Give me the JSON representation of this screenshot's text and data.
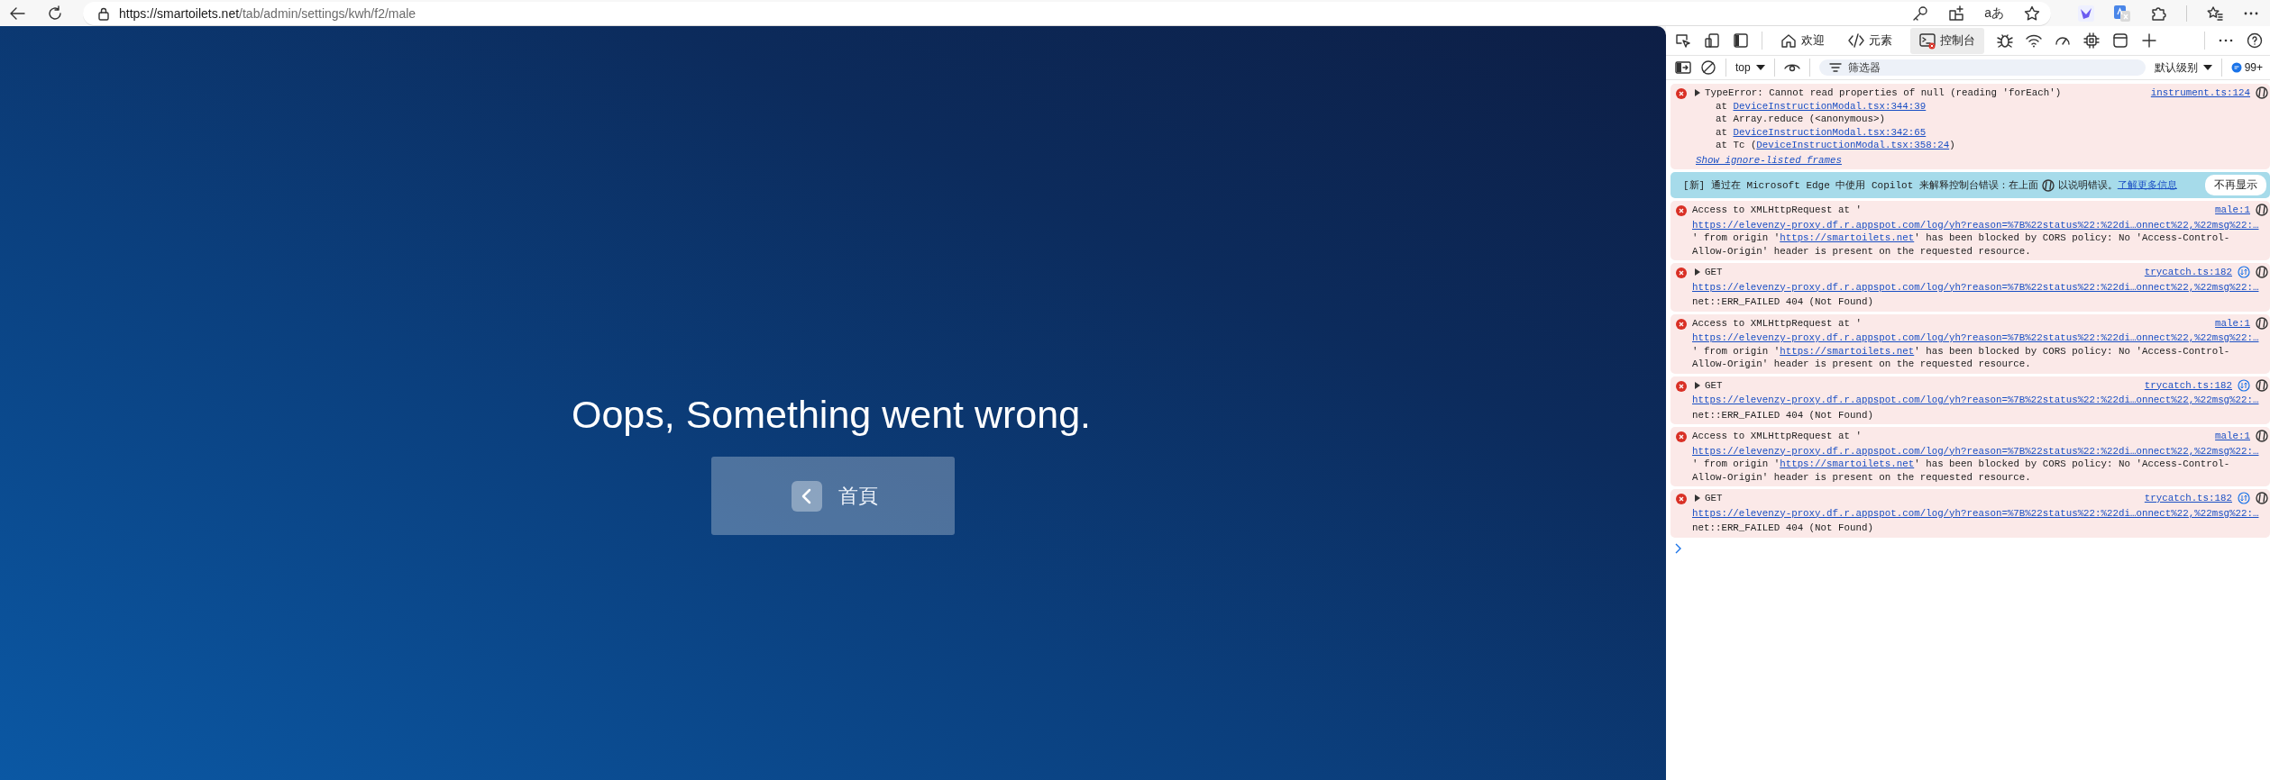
{
  "browser": {
    "url_host": "https://smartoilets.net",
    "url_path": "/tab/admin/settings/kwh/f2/male",
    "read_aloud_label": "aあ"
  },
  "page": {
    "message": "Oops, Something went wrong.",
    "home_button": "首頁"
  },
  "devtools": {
    "tabs": [
      {
        "label": "欢迎",
        "kind": "home",
        "selected": false
      },
      {
        "label": "元素",
        "kind": "code",
        "selected": false
      },
      {
        "label": "控制台",
        "kind": "console",
        "selected": true
      }
    ],
    "toolbar": {
      "context": "top",
      "filter_placeholder": "筛选器",
      "log_level": "默认级别",
      "issues_count": "99+"
    },
    "messages": [
      {
        "kind": "error",
        "expanded": false,
        "text": "TypeError: Cannot read properties of null (reading 'forEach')",
        "source": "instrument.ts:124",
        "stack": [
          {
            "text": "at ",
            "link": "DeviceInstructionModal.tsx:344:39"
          },
          {
            "text": "at Array.reduce (<anonymous>)"
          },
          {
            "text": "at ",
            "link": "DeviceInstructionModal.tsx:342:65"
          },
          {
            "text": "at Tc (",
            "link": "DeviceInstructionModal.tsx:358:24",
            "suffix": ")"
          }
        ],
        "ignore_link": "Show ignore-listed frames"
      },
      {
        "kind": "banner",
        "text": "[新] 通过在 Microsoft Edge 中使用 Copilot 来解释控制台错误：在上面",
        "text_after": "以说明错误。",
        "link": "了解更多信息",
        "button": "不再显示"
      },
      {
        "kind": "cors",
        "text": "Access to XMLHttpRequest at '",
        "url": "https://elevenzy-proxy.df.r.appspot.com/log/yh?reason=%7B%22status%22:%22di…onnect%22,%22msg%22:…",
        "before": "' from origin '",
        "origin": "https://smartoilets.net",
        "after": "' has been blocked by CORS policy: No 'Access-Control-Allow-Origin' header is present on the requested resource.",
        "source": "male:1"
      },
      {
        "kind": "get",
        "expanded": false,
        "text": "GET",
        "url": "https://elevenzy-proxy.df.r.appspot.com/log/yh?reason=%7B%22status%22:%22di…onnect%22,%22msg%22:…",
        "status": "net::ERR_FAILED 404 (Not Found)",
        "source": "trycatch.ts:182"
      },
      {
        "kind": "cors",
        "text": "Access to XMLHttpRequest at '",
        "url": "https://elevenzy-proxy.df.r.appspot.com/log/yh?reason=%7B%22status%22:%22di…onnect%22,%22msg%22:…",
        "before": "' from origin '",
        "origin": "https://smartoilets.net",
        "after": "' has been blocked by CORS policy: No 'Access-Control-Allow-Origin' header is present on the requested resource.",
        "source": "male:1"
      },
      {
        "kind": "get",
        "expanded": false,
        "text": "GET",
        "url": "https://elevenzy-proxy.df.r.appspot.com/log/yh?reason=%7B%22status%22:%22di…onnect%22,%22msg%22:…",
        "status": "net::ERR_FAILED 404 (Not Found)",
        "source": "trycatch.ts:182"
      },
      {
        "kind": "cors",
        "text": "Access to XMLHttpRequest at '",
        "url": "https://elevenzy-proxy.df.r.appspot.com/log/yh?reason=%7B%22status%22:%22di…onnect%22,%22msg%22:…",
        "before": "' from origin '",
        "origin": "https://smartoilets.net",
        "after": "' has been blocked by CORS policy: No 'Access-Control-Allow-Origin' header is present on the requested resource.",
        "source": "male:1"
      },
      {
        "kind": "get",
        "expanded": false,
        "text": "GET",
        "url": "https://elevenzy-proxy.df.r.appspot.com/log/yh?reason=%7B%22status%22:%22di…onnect%22,%22msg%22:…",
        "status": "net::ERR_FAILED 404 (Not Found)",
        "source": "trycatch.ts:182"
      }
    ]
  }
}
